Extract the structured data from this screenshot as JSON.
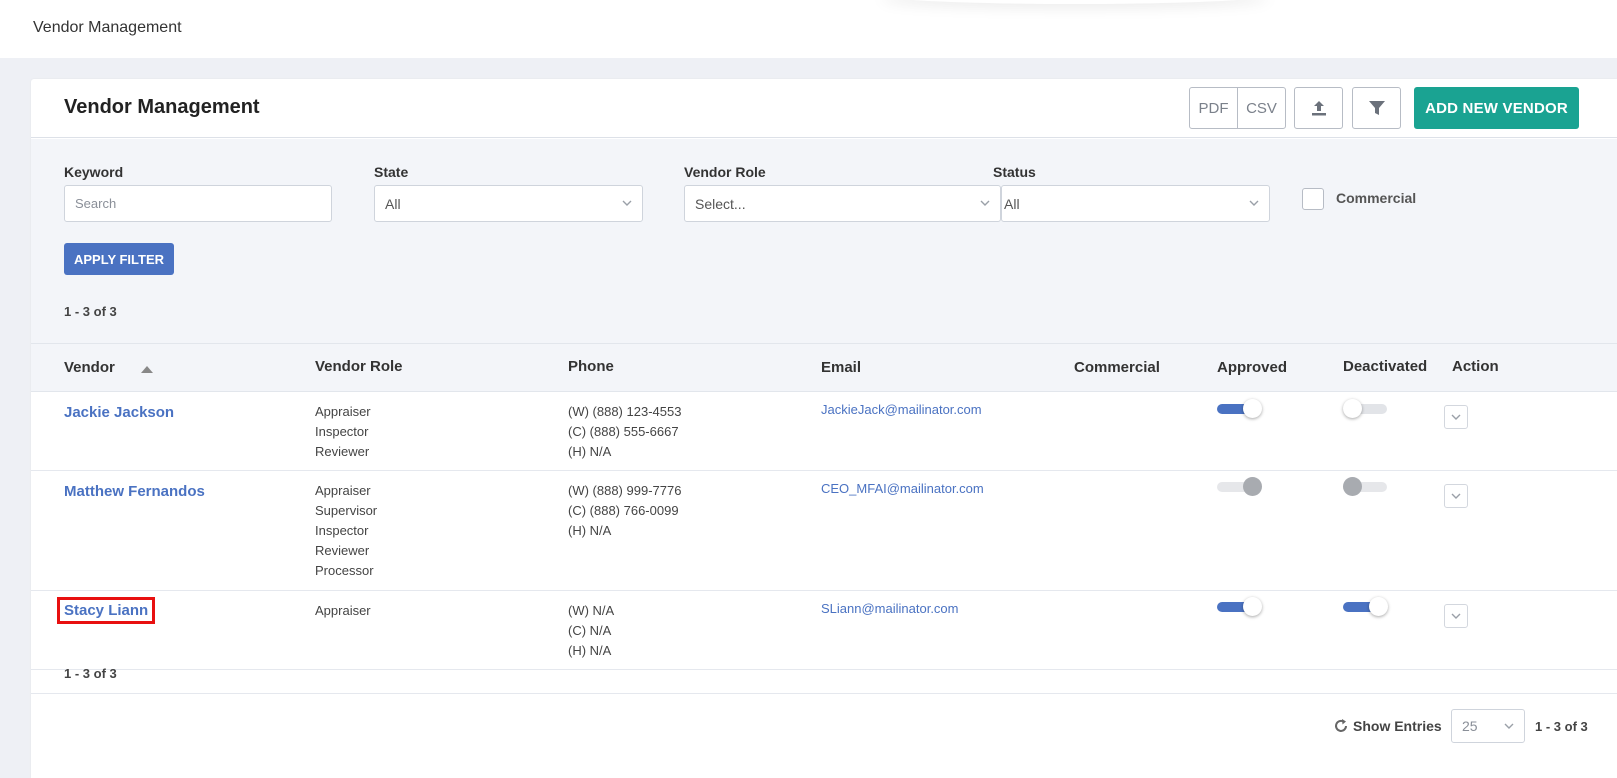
{
  "topbar": {
    "title": "Vendor Management"
  },
  "header": {
    "title": "Vendor Management",
    "pdf_label": "PDF",
    "csv_label": "CSV",
    "add_label": "ADD NEW VENDOR",
    "accent_color": "#1aa392"
  },
  "filters": {
    "keyword_label": "Keyword",
    "keyword_placeholder": "Search",
    "state_label": "State",
    "state_value": "All",
    "role_label": "Vendor Role",
    "role_value": "Select...",
    "status_label": "Status",
    "status_value": "All",
    "commercial_label": "Commercial",
    "commercial_checked": false,
    "apply_label": "APPLY FILTER"
  },
  "pagination": {
    "count_top": "1 - 3 of 3",
    "count_bottom": "1 - 3 of 3",
    "show_entries_label": "Show Entries",
    "entries_value": "25",
    "page_count": "1 - 3 of 3"
  },
  "table": {
    "columns": {
      "vendor": "Vendor",
      "role": "Vendor Role",
      "phone": "Phone",
      "email": "Email",
      "commercial": "Commercial",
      "approved": "Approved",
      "deactivated": "Deactivated",
      "action": "Action"
    },
    "rows": [
      {
        "name": "Jackie Jackson",
        "roles": [
          "Appraiser",
          "Inspector",
          "Reviewer"
        ],
        "phones": [
          "(W) (888) 123-4553",
          "(C) (888) 555-6667",
          "(H) N/A"
        ],
        "email": "JackieJack@mailinator.com",
        "commercial": "",
        "approved": "on",
        "deactivated": "off"
      },
      {
        "name": "Matthew Fernandos",
        "roles": [
          "Appraiser",
          "Supervisor",
          "Inspector",
          "Reviewer",
          "Processor"
        ],
        "phones": [
          "(W) (888) 999-7776",
          "(C) (888) 766-0099",
          "(H) N/A"
        ],
        "email": "CEO_MFAI@mailinator.com",
        "commercial": "",
        "approved": "disabled-on",
        "deactivated": "disabled-off"
      },
      {
        "name": "Stacy Liann",
        "roles": [
          "Appraiser"
        ],
        "phones": [
          "(W) N/A",
          "(C) N/A",
          "(H) N/A"
        ],
        "email": "SLiann@mailinator.com",
        "commercial": "",
        "approved": "on",
        "deactivated": "on"
      }
    ]
  },
  "colors": {
    "link": "#4a72c2",
    "apply": "#4a72c2",
    "highlight": "#e81010"
  }
}
